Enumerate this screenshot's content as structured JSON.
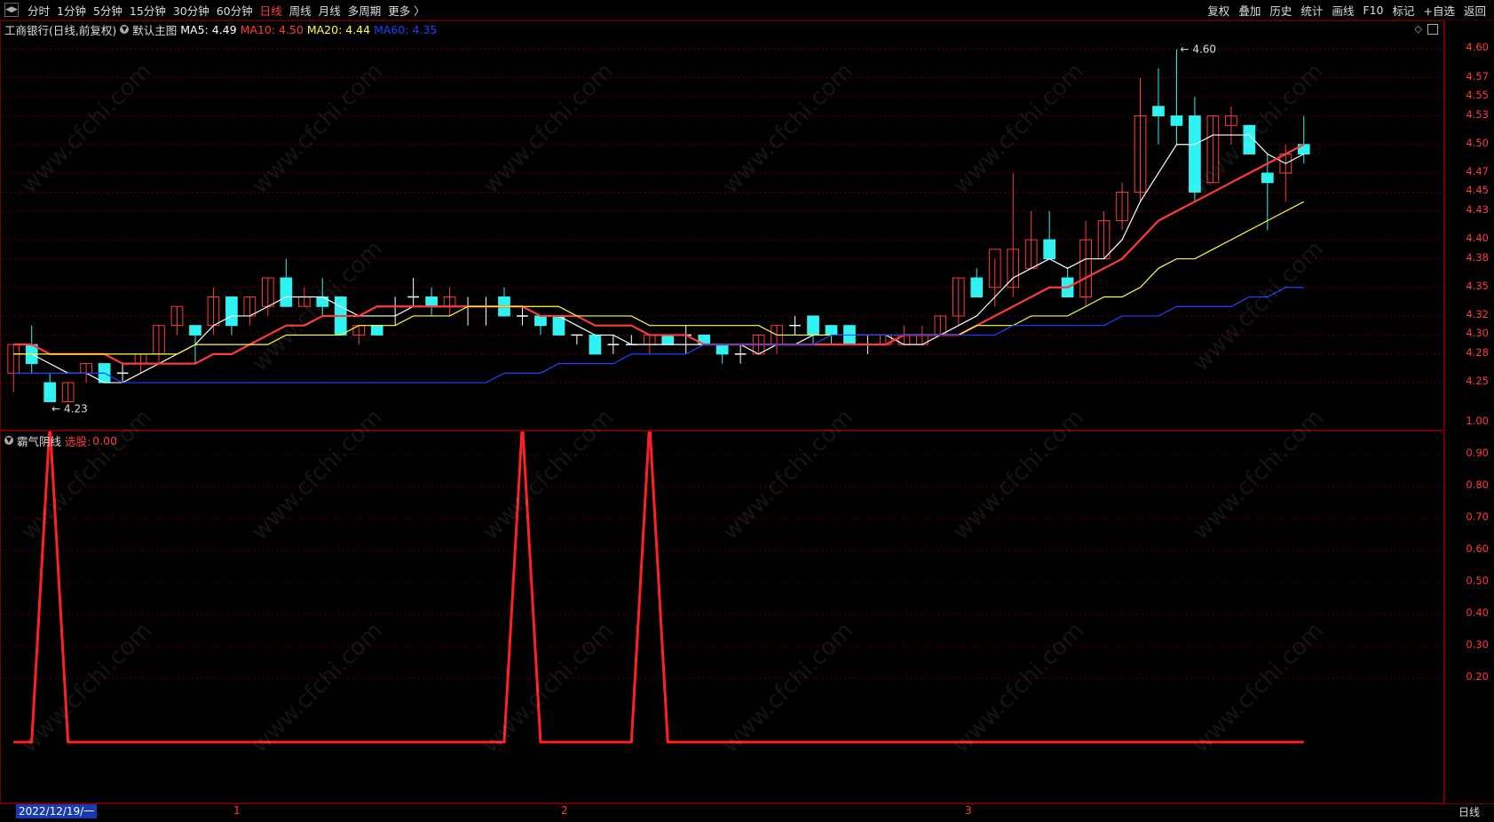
{
  "toolbar": {
    "periods": [
      "分时",
      "1分钟",
      "5分钟",
      "15分钟",
      "30分钟",
      "60分钟",
      "日线",
      "周线",
      "月线",
      "多周期",
      "更多 〉"
    ],
    "active_period": "日线",
    "actions": [
      "复权",
      "叠加",
      "历史",
      "统计",
      "画线",
      "F10",
      "标记",
      "+自选",
      "返回"
    ]
  },
  "main_panel": {
    "title": "工商银行(日线,前复权)",
    "template_label": "默认主图",
    "ma": [
      {
        "label": "MA5:",
        "value": "4.49",
        "color": "#ffffff"
      },
      {
        "label": "MA10:",
        "value": "4.50",
        "color": "#ff3b3b"
      },
      {
        "label": "MA20:",
        "value": "4.44",
        "color": "#ffff40"
      },
      {
        "label": "MA60:",
        "value": "4.35",
        "color": "#2040ff"
      }
    ],
    "y_ticks": [
      "4.60",
      "4.57",
      "4.55",
      "4.53",
      "4.50",
      "4.47",
      "4.45",
      "4.43",
      "4.40",
      "4.38",
      "4.35",
      "4.32",
      "4.30",
      "4.28",
      "4.25"
    ],
    "high_label": "4.60",
    "low_label": "4.23"
  },
  "sub_panel": {
    "title": "霸气阴线",
    "select_label": "选股:",
    "select_value": "0.00",
    "y_ticks": [
      "1.00",
      "0.90",
      "0.80",
      "0.70",
      "0.60",
      "0.50",
      "0.40",
      "0.30",
      "0.20"
    ]
  },
  "x_axis": {
    "cursor_date": "2022/12/19/一",
    "month_labels": [
      "1",
      "2",
      "3"
    ]
  },
  "period_tag": "日线",
  "watermark": "www.cfchi.com",
  "chart_data": [
    {
      "type": "candlestick",
      "title": "工商银行(日线,前复权)",
      "ylim": [
        4.21,
        4.62
      ],
      "candles": [
        {
          "o": 4.26,
          "h": 4.29,
          "l": 4.24,
          "c": 4.29
        },
        {
          "o": 4.29,
          "h": 4.31,
          "l": 4.26,
          "c": 4.27
        },
        {
          "o": 4.25,
          "h": 4.26,
          "l": 4.23,
          "c": 4.23
        },
        {
          "o": 4.23,
          "h": 4.25,
          "l": 4.23,
          "c": 4.25
        },
        {
          "o": 4.26,
          "h": 4.27,
          "l": 4.25,
          "c": 4.27
        },
        {
          "o": 4.27,
          "h": 4.27,
          "l": 4.25,
          "c": 4.25
        },
        {
          "o": 4.26,
          "h": 4.27,
          "l": 4.25,
          "c": 4.26
        },
        {
          "o": 4.27,
          "h": 4.28,
          "l": 4.26,
          "c": 4.28
        },
        {
          "o": 4.28,
          "h": 4.31,
          "l": 4.27,
          "c": 4.31
        },
        {
          "o": 4.31,
          "h": 4.33,
          "l": 4.3,
          "c": 4.33
        },
        {
          "o": 4.31,
          "h": 4.31,
          "l": 4.27,
          "c": 4.3
        },
        {
          "o": 4.31,
          "h": 4.35,
          "l": 4.3,
          "c": 4.34
        },
        {
          "o": 4.34,
          "h": 4.34,
          "l": 4.3,
          "c": 4.31
        },
        {
          "o": 4.32,
          "h": 4.34,
          "l": 4.31,
          "c": 4.34
        },
        {
          "o": 4.33,
          "h": 4.36,
          "l": 4.32,
          "c": 4.36
        },
        {
          "o": 4.36,
          "h": 4.38,
          "l": 4.33,
          "c": 4.33
        },
        {
          "o": 4.33,
          "h": 4.35,
          "l": 4.33,
          "c": 4.34
        },
        {
          "o": 4.34,
          "h": 4.36,
          "l": 4.32,
          "c": 4.33
        },
        {
          "o": 4.34,
          "h": 4.34,
          "l": 4.3,
          "c": 4.3
        },
        {
          "o": 4.3,
          "h": 4.31,
          "l": 4.29,
          "c": 4.31
        },
        {
          "o": 4.31,
          "h": 4.31,
          "l": 4.3,
          "c": 4.3
        },
        {
          "o": 4.33,
          "h": 4.34,
          "l": 4.31,
          "c": 4.33
        },
        {
          "o": 4.34,
          "h": 4.36,
          "l": 4.33,
          "c": 4.34
        },
        {
          "o": 4.34,
          "h": 4.35,
          "l": 4.32,
          "c": 4.33
        },
        {
          "o": 4.33,
          "h": 4.35,
          "l": 4.32,
          "c": 4.34
        },
        {
          "o": 4.33,
          "h": 4.34,
          "l": 4.31,
          "c": 4.33
        },
        {
          "o": 4.33,
          "h": 4.34,
          "l": 4.31,
          "c": 4.33
        },
        {
          "o": 4.34,
          "h": 4.35,
          "l": 4.32,
          "c": 4.32
        },
        {
          "o": 4.32,
          "h": 4.33,
          "l": 4.31,
          "c": 4.32
        },
        {
          "o": 4.32,
          "h": 4.32,
          "l": 4.3,
          "c": 4.31
        },
        {
          "o": 4.32,
          "h": 4.32,
          "l": 4.3,
          "c": 4.3
        },
        {
          "o": 4.3,
          "h": 4.3,
          "l": 4.29,
          "c": 4.3
        },
        {
          "o": 4.3,
          "h": 4.3,
          "l": 4.28,
          "c": 4.28
        },
        {
          "o": 4.29,
          "h": 4.3,
          "l": 4.28,
          "c": 4.29
        },
        {
          "o": 4.29,
          "h": 4.3,
          "l": 4.29,
          "c": 4.29
        },
        {
          "o": 4.29,
          "h": 4.3,
          "l": 4.28,
          "c": 4.3
        },
        {
          "o": 4.3,
          "h": 4.3,
          "l": 4.29,
          "c": 4.29
        },
        {
          "o": 4.3,
          "h": 4.31,
          "l": 4.28,
          "c": 4.3
        },
        {
          "o": 4.3,
          "h": 4.3,
          "l": 4.29,
          "c": 4.29
        },
        {
          "o": 4.29,
          "h": 4.29,
          "l": 4.27,
          "c": 4.28
        },
        {
          "o": 4.28,
          "h": 4.29,
          "l": 4.27,
          "c": 4.28
        },
        {
          "o": 4.28,
          "h": 4.3,
          "l": 4.28,
          "c": 4.3
        },
        {
          "o": 4.29,
          "h": 4.31,
          "l": 4.28,
          "c": 4.31
        },
        {
          "o": 4.31,
          "h": 4.32,
          "l": 4.3,
          "c": 4.31
        },
        {
          "o": 4.32,
          "h": 4.32,
          "l": 4.29,
          "c": 4.3
        },
        {
          "o": 4.31,
          "h": 4.31,
          "l": 4.29,
          "c": 4.3
        },
        {
          "o": 4.31,
          "h": 4.31,
          "l": 4.29,
          "c": 4.29
        },
        {
          "o": 4.29,
          "h": 4.3,
          "l": 4.28,
          "c": 4.29
        },
        {
          "o": 4.29,
          "h": 4.3,
          "l": 4.29,
          "c": 4.3
        },
        {
          "o": 4.29,
          "h": 4.31,
          "l": 4.29,
          "c": 4.3
        },
        {
          "o": 4.29,
          "h": 4.31,
          "l": 4.29,
          "c": 4.3
        },
        {
          "o": 4.3,
          "h": 4.32,
          "l": 4.3,
          "c": 4.32
        },
        {
          "o": 4.32,
          "h": 4.36,
          "l": 4.31,
          "c": 4.36
        },
        {
          "o": 4.36,
          "h": 4.37,
          "l": 4.34,
          "c": 4.34
        },
        {
          "o": 4.35,
          "h": 4.38,
          "l": 4.33,
          "c": 4.39
        },
        {
          "o": 4.35,
          "h": 4.47,
          "l": 4.34,
          "c": 4.39
        },
        {
          "o": 4.37,
          "h": 4.43,
          "l": 4.37,
          "c": 4.4
        },
        {
          "o": 4.4,
          "h": 4.43,
          "l": 4.38,
          "c": 4.38
        },
        {
          "o": 4.36,
          "h": 4.37,
          "l": 4.34,
          "c": 4.34
        },
        {
          "o": 4.34,
          "h": 4.42,
          "l": 4.33,
          "c": 4.4
        },
        {
          "o": 4.38,
          "h": 4.43,
          "l": 4.38,
          "c": 4.42
        },
        {
          "o": 4.42,
          "h": 4.46,
          "l": 4.41,
          "c": 4.45
        },
        {
          "o": 4.45,
          "h": 4.57,
          "l": 4.44,
          "c": 4.53
        },
        {
          "o": 4.54,
          "h": 4.58,
          "l": 4.5,
          "c": 4.53
        },
        {
          "o": 4.53,
          "h": 4.6,
          "l": 4.5,
          "c": 4.52
        },
        {
          "o": 4.53,
          "h": 4.55,
          "l": 4.44,
          "c": 4.45
        },
        {
          "o": 4.46,
          "h": 4.53,
          "l": 4.46,
          "c": 4.53
        },
        {
          "o": 4.52,
          "h": 4.54,
          "l": 4.5,
          "c": 4.53
        },
        {
          "o": 4.52,
          "h": 4.52,
          "l": 4.49,
          "c": 4.49
        },
        {
          "o": 4.47,
          "h": 4.49,
          "l": 4.41,
          "c": 4.46
        },
        {
          "o": 4.47,
          "h": 4.5,
          "l": 4.44,
          "c": 4.49
        },
        {
          "o": 4.5,
          "h": 4.53,
          "l": 4.48,
          "c": 4.49
        }
      ],
      "series": [
        {
          "name": "MA5",
          "color": "#ffffff",
          "values": [
            4.28,
            4.28,
            4.27,
            4.26,
            4.26,
            4.25,
            4.25,
            4.26,
            4.27,
            4.28,
            4.29,
            4.31,
            4.32,
            4.32,
            4.33,
            4.34,
            4.34,
            4.34,
            4.33,
            4.32,
            4.32,
            4.32,
            4.33,
            4.33,
            4.33,
            4.33,
            4.33,
            4.33,
            4.33,
            4.32,
            4.32,
            4.31,
            4.3,
            4.3,
            4.29,
            4.29,
            4.29,
            4.29,
            4.29,
            4.29,
            4.29,
            4.28,
            4.29,
            4.29,
            4.3,
            4.3,
            4.3,
            4.3,
            4.3,
            4.29,
            4.29,
            4.3,
            4.31,
            4.32,
            4.34,
            4.36,
            4.37,
            4.38,
            4.37,
            4.38,
            4.38,
            4.4,
            4.44,
            4.47,
            4.5,
            4.5,
            4.51,
            4.51,
            4.51,
            4.49,
            4.48,
            4.49
          ]
        },
        {
          "name": "MA10",
          "color": "#ff3b3b",
          "values": [
            4.29,
            4.29,
            4.28,
            4.28,
            4.28,
            4.28,
            4.27,
            4.27,
            4.27,
            4.27,
            4.27,
            4.28,
            4.28,
            4.29,
            4.3,
            4.31,
            4.31,
            4.32,
            4.32,
            4.32,
            4.33,
            4.33,
            4.33,
            4.33,
            4.33,
            4.33,
            4.33,
            4.33,
            4.33,
            4.32,
            4.32,
            4.32,
            4.31,
            4.31,
            4.31,
            4.3,
            4.3,
            4.3,
            4.29,
            4.29,
            4.29,
            4.29,
            4.29,
            4.29,
            4.29,
            4.29,
            4.29,
            4.29,
            4.29,
            4.3,
            4.3,
            4.3,
            4.3,
            4.31,
            4.32,
            4.33,
            4.34,
            4.35,
            4.35,
            4.36,
            4.37,
            4.38,
            4.4,
            4.42,
            4.43,
            4.44,
            4.45,
            4.46,
            4.47,
            4.48,
            4.49,
            4.5
          ]
        },
        {
          "name": "MA20",
          "color": "#ffff40",
          "values": [
            4.28,
            4.28,
            4.28,
            4.28,
            4.28,
            4.28,
            4.28,
            4.28,
            4.28,
            4.28,
            4.29,
            4.29,
            4.29,
            4.29,
            4.29,
            4.3,
            4.3,
            4.3,
            4.3,
            4.31,
            4.31,
            4.31,
            4.32,
            4.32,
            4.32,
            4.33,
            4.33,
            4.33,
            4.33,
            4.33,
            4.33,
            4.32,
            4.32,
            4.32,
            4.32,
            4.31,
            4.31,
            4.31,
            4.31,
            4.31,
            4.31,
            4.31,
            4.3,
            4.3,
            4.3,
            4.3,
            4.3,
            4.3,
            4.3,
            4.3,
            4.3,
            4.3,
            4.3,
            4.31,
            4.31,
            4.31,
            4.32,
            4.32,
            4.32,
            4.33,
            4.34,
            4.34,
            4.35,
            4.37,
            4.38,
            4.38,
            4.39,
            4.4,
            4.41,
            4.42,
            4.43,
            4.44
          ]
        },
        {
          "name": "MA60",
          "color": "#2040ff",
          "values": [
            4.26,
            4.26,
            4.26,
            4.26,
            4.26,
            4.26,
            4.25,
            4.25,
            4.25,
            4.25,
            4.25,
            4.25,
            4.25,
            4.25,
            4.25,
            4.25,
            4.25,
            4.25,
            4.25,
            4.25,
            4.25,
            4.25,
            4.25,
            4.25,
            4.25,
            4.25,
            4.25,
            4.26,
            4.26,
            4.26,
            4.27,
            4.27,
            4.27,
            4.27,
            4.28,
            4.28,
            4.28,
            4.28,
            4.29,
            4.29,
            4.29,
            4.29,
            4.29,
            4.29,
            4.29,
            4.3,
            4.3,
            4.3,
            4.3,
            4.3,
            4.3,
            4.3,
            4.3,
            4.3,
            4.3,
            4.31,
            4.31,
            4.31,
            4.31,
            4.31,
            4.31,
            4.32,
            4.32,
            4.32,
            4.33,
            4.33,
            4.33,
            4.33,
            4.34,
            4.34,
            4.35,
            4.35
          ]
        }
      ]
    },
    {
      "type": "line",
      "title": "霸气阴线",
      "ylim": [
        0,
        1.05
      ],
      "series": [
        {
          "name": "选股",
          "color": "#ff2020",
          "values": [
            0,
            0,
            1,
            0,
            0,
            0,
            0,
            0,
            0,
            0,
            0,
            0,
            0,
            0,
            0,
            0,
            0,
            0,
            0,
            0,
            0,
            0,
            0,
            0,
            0,
            0,
            0,
            0,
            1,
            0,
            0,
            0,
            0,
            0,
            0,
            1,
            0,
            0,
            0,
            0,
            0,
            0,
            0,
            0,
            0,
            0,
            0,
            0,
            0,
            0,
            0,
            0,
            0,
            0,
            0,
            0,
            0,
            0,
            0,
            0,
            0,
            0,
            0,
            0,
            0,
            0,
            0,
            0,
            0,
            0,
            0,
            0
          ]
        }
      ]
    }
  ]
}
